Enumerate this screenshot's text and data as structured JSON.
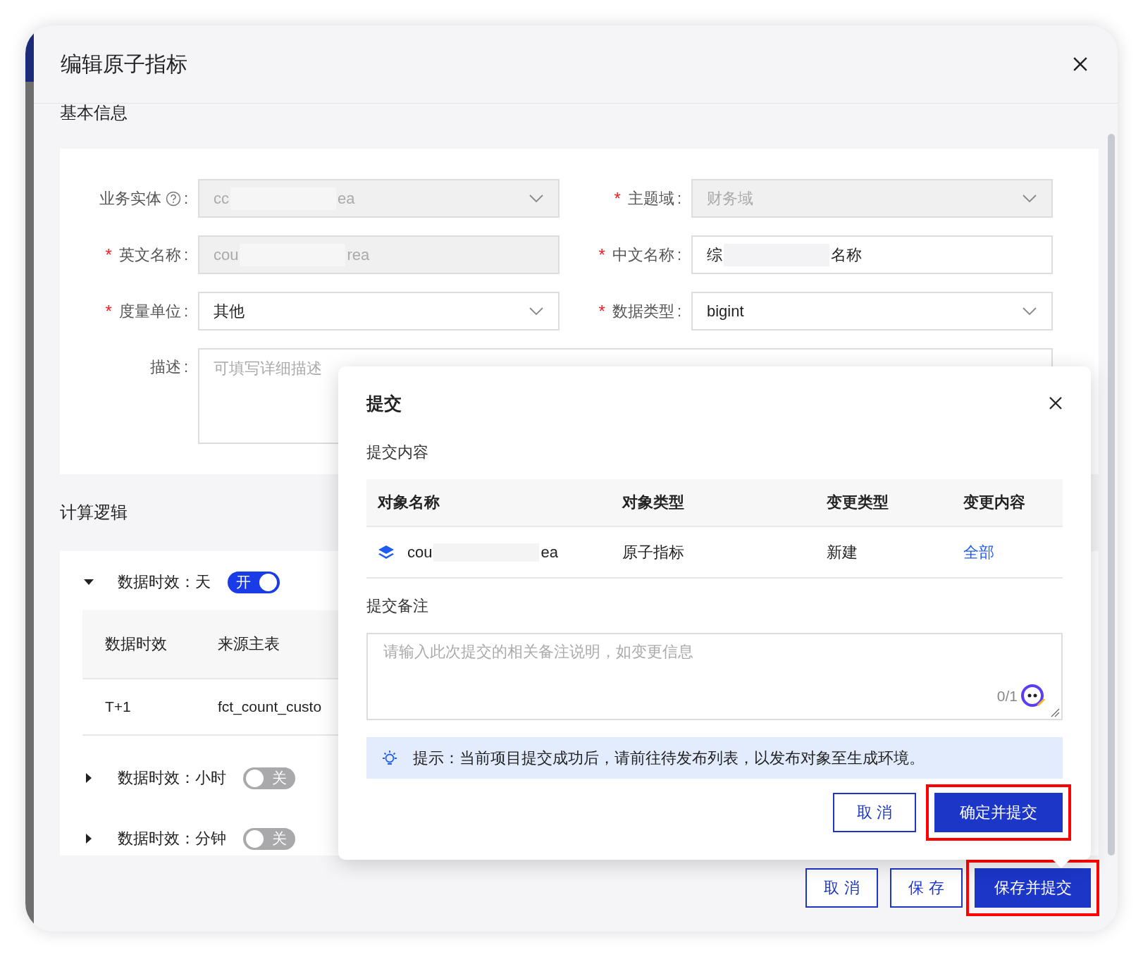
{
  "dialog": {
    "title": "编辑原子指标"
  },
  "basic_info": {
    "heading": "基本信息",
    "fields": [
      {
        "label": "业务实体",
        "colon": ":",
        "help": true,
        "kind": "select",
        "disabled": true,
        "value_parts": [
          "cc",
          "ea"
        ]
      },
      {
        "label": "主题域",
        "colon": ":",
        "required_mark": "*",
        "help": false,
        "kind": "select",
        "disabled": true,
        "value_parts": [
          "财务域"
        ]
      },
      {
        "label": "英文名称",
        "colon": ":",
        "required_mark": "*",
        "help": false,
        "kind": "input",
        "disabled": true,
        "value_parts": [
          "cou",
          "rea"
        ]
      },
      {
        "label": "中文名称",
        "colon": ":",
        "required_mark": "*",
        "help": false,
        "kind": "input",
        "disabled": false,
        "value_parts": [
          "综",
          "名称"
        ]
      },
      {
        "label": "度量单位",
        "colon": ":",
        "required_mark": "*",
        "help": false,
        "kind": "select",
        "disabled": false,
        "value_parts": [
          "其他"
        ]
      },
      {
        "label": "数据类型",
        "colon": ":",
        "required_mark": "*",
        "help": false,
        "kind": "select",
        "disabled": false,
        "value_parts": [
          "bigint"
        ]
      },
      {
        "label": "描述",
        "colon": ":",
        "help": false,
        "kind": "textarea",
        "disabled": false,
        "placeholder": "可填写详细描述"
      }
    ]
  },
  "calc_logic": {
    "heading": "计算逻辑",
    "groups": [
      {
        "label": "数据时效：天",
        "expanded": true,
        "on": true,
        "switch_text": "开",
        "table": {
          "columns": [
            "数据时效",
            "来源主表"
          ],
          "rows": [
            [
              "T+1",
              "fct_count_custo"
            ]
          ]
        }
      },
      {
        "label": "数据时效：小时",
        "expanded": false,
        "on": false,
        "switch_text": "关"
      },
      {
        "label": "数据时效：分钟",
        "expanded": false,
        "on": false,
        "switch_text": "关"
      }
    ]
  },
  "footer_buttons": [
    {
      "label": "取 消",
      "kind": "secondary",
      "highlighted": false
    },
    {
      "label": "保 存",
      "kind": "secondary",
      "highlighted": false
    },
    {
      "label": "保存并提交",
      "kind": "primary",
      "highlighted": true
    }
  ],
  "submit_popup": {
    "title": "提交",
    "content_heading": "提交内容",
    "table": {
      "columns": [
        "对象名称",
        "对象类型",
        "变更类型",
        "变更内容"
      ],
      "rows": [
        {
          "name_parts": [
            "cou",
            "ea"
          ],
          "object_type": "原子指标",
          "change_type": "新建",
          "change_content": "全部"
        }
      ]
    },
    "note_heading": "提交备注",
    "note": {
      "placeholder": "请输入此次提交的相关备注说明，如变更信息",
      "counter": "0/1"
    },
    "hint": "提示：当前项目提交成功后，请前往待发布列表，以发布对象至生成环境。",
    "buttons": [
      {
        "label": "取 消",
        "kind": "secondary",
        "highlighted": false
      },
      {
        "label": "确定并提交",
        "kind": "primary",
        "highlighted": true
      }
    ]
  }
}
